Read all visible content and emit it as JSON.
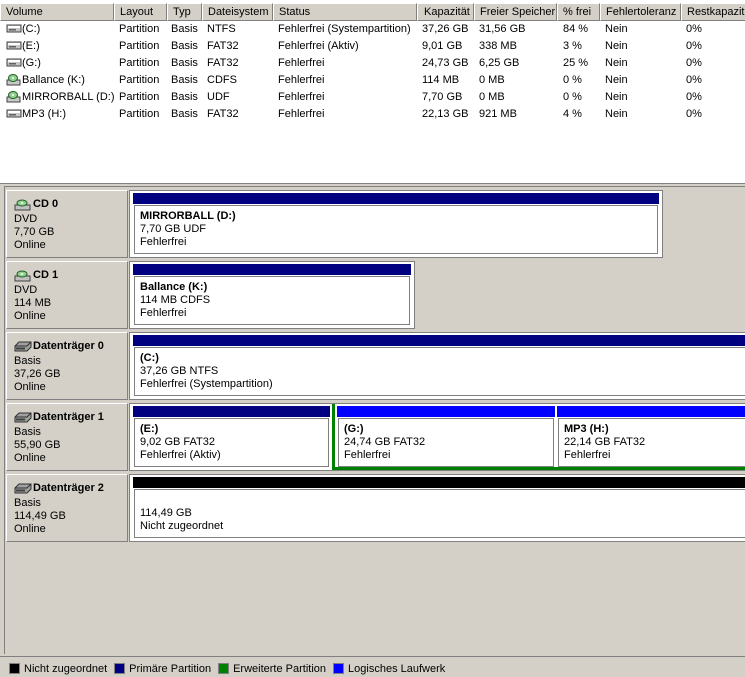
{
  "colors": {
    "unallocated": "#000000",
    "primary": "#000080",
    "extended": "#008000",
    "logical": "#0000ff"
  },
  "volume_list": {
    "columns": [
      "Volume",
      "Layout",
      "Typ",
      "Dateisystem",
      "Status",
      "Kapazität",
      "Freier Speicher",
      "% frei",
      "Fehlertoleranz",
      "Restkapazität"
    ],
    "rows": [
      {
        "icon": "hard-disk-volume-icon",
        "volume": "(C:)",
        "layout": "Partition",
        "typ": "Basis",
        "fs": "NTFS",
        "status": "Fehlerfrei (Systempartition)",
        "capacity": "37,26 GB",
        "free": "31,56 GB",
        "pct": "84 %",
        "fault": "Nein",
        "overhead": "0%"
      },
      {
        "icon": "hard-disk-volume-icon",
        "volume": "(E:)",
        "layout": "Partition",
        "typ": "Basis",
        "fs": "FAT32",
        "status": "Fehlerfrei (Aktiv)",
        "capacity": "9,01 GB",
        "free": "338 MB",
        "pct": "3 %",
        "fault": "Nein",
        "overhead": "0%"
      },
      {
        "icon": "hard-disk-volume-icon",
        "volume": "(G:)",
        "layout": "Partition",
        "typ": "Basis",
        "fs": "FAT32",
        "status": "Fehlerfrei",
        "capacity": "24,73 GB",
        "free": "6,25 GB",
        "pct": "25 %",
        "fault": "Nein",
        "overhead": "0%"
      },
      {
        "icon": "cd-volume-icon",
        "volume": "Ballance (K:)",
        "layout": "Partition",
        "typ": "Basis",
        "fs": "CDFS",
        "status": "Fehlerfrei",
        "capacity": "114 MB",
        "free": "0 MB",
        "pct": "0 %",
        "fault": "Nein",
        "overhead": "0%"
      },
      {
        "icon": "cd-volume-icon",
        "volume": "MIRRORBALL (D:)",
        "layout": "Partition",
        "typ": "Basis",
        "fs": "UDF",
        "status": "Fehlerfrei",
        "capacity": "7,70 GB",
        "free": "0 MB",
        "pct": "0 %",
        "fault": "Nein",
        "overhead": "0%"
      },
      {
        "icon": "hard-disk-volume-icon",
        "volume": "MP3 (H:)",
        "layout": "Partition",
        "typ": "Basis",
        "fs": "FAT32",
        "status": "Fehlerfrei",
        "capacity": "22,13 GB",
        "free": "921 MB",
        "pct": "4 %",
        "fault": "Nein",
        "overhead": "0%"
      }
    ]
  },
  "disks": [
    {
      "name": "CD 0",
      "icon": "cd-drive-icon",
      "type": "DVD",
      "size": "7,70 GB",
      "state": "Online",
      "partitions": [
        {
          "kind": "primary",
          "name": "MIRRORBALL  (D:)",
          "detail": "7,70 GB UDF",
          "status": "Fehlerfrei"
        }
      ]
    },
    {
      "name": "CD 1",
      "icon": "cd-drive-icon",
      "type": "DVD",
      "size": "114 MB",
      "state": "Online",
      "partitions": [
        {
          "kind": "primary",
          "name": "Ballance  (K:)",
          "detail": "114 MB CDFS",
          "status": "Fehlerfrei"
        }
      ]
    },
    {
      "name": "Datenträger 0",
      "icon": "hard-disk-icon",
      "type": "Basis",
      "size": "37,26 GB",
      "state": "Online",
      "partitions": [
        {
          "kind": "primary",
          "name": "(C:)",
          "detail": "37,26 GB NTFS",
          "status": "Fehlerfrei (Systempartition)"
        }
      ]
    },
    {
      "name": "Datenträger 1",
      "icon": "hard-disk-icon",
      "type": "Basis",
      "size": "55,90 GB",
      "state": "Online",
      "partitions": [
        {
          "kind": "primary",
          "name": "(E:)",
          "detail": "9,02 GB FAT32",
          "status": "Fehlerfrei (Aktiv)"
        },
        {
          "kind": "logical",
          "name": "(G:)",
          "detail": "24,74 GB FAT32",
          "status": "Fehlerfrei"
        },
        {
          "kind": "logical",
          "name": "MP3  (H:)",
          "detail": "22,14 GB FAT32",
          "status": "Fehlerfrei"
        }
      ]
    },
    {
      "name": "Datenträger 2",
      "icon": "hard-disk-icon",
      "type": "Basis",
      "size": "114,49 GB",
      "state": "Online",
      "partitions": [
        {
          "kind": "unallocated",
          "name": "",
          "detail": "114,49 GB",
          "status": "Nicht zugeordnet"
        }
      ]
    }
  ],
  "legend": [
    {
      "label": "Nicht zugeordnet",
      "color": "#000000"
    },
    {
      "label": "Primäre Partition",
      "color": "#000080"
    },
    {
      "label": "Erweiterte Partition",
      "color": "#008000"
    },
    {
      "label": "Logisches Laufwerk",
      "color": "#0000ff"
    }
  ]
}
